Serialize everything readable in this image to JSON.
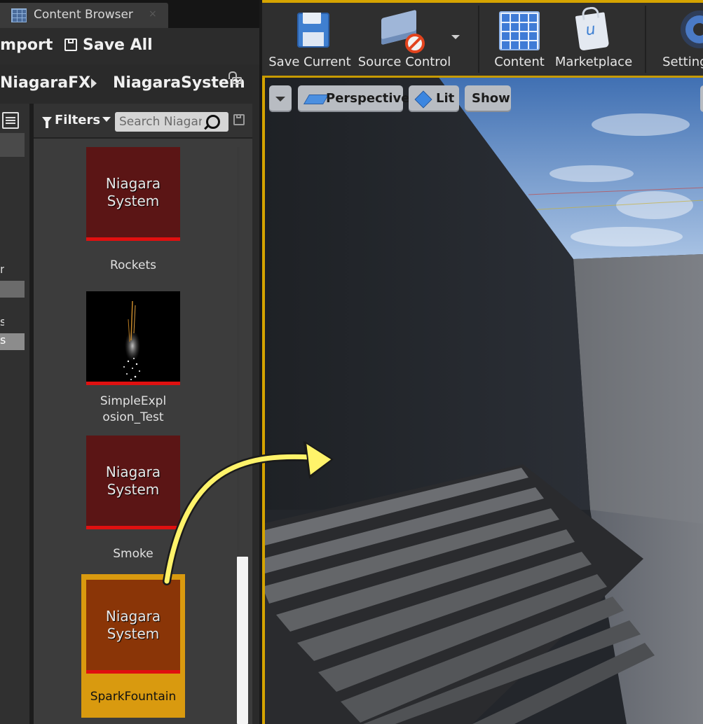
{
  "content_browser": {
    "tab_title": "Content Browser",
    "tab_close": "×",
    "toolbar": {
      "import_label": "Import",
      "save_all_label": "Save All"
    },
    "path": [
      "NiagaraFX",
      "NiagaraSystem"
    ],
    "sources_rows": [
      "n",
      "s",
      "s"
    ],
    "filters_label": "Filters",
    "search_placeholder": "Search Niagara",
    "assets": [
      {
        "name": "Rockets",
        "thumb_text": "Niagara System",
        "selected": false
      },
      {
        "name": "SimpleExplosion_Test",
        "thumb_text": "",
        "selected": false
      },
      {
        "name": "Smoke",
        "thumb_text": "Niagara System",
        "selected": false
      },
      {
        "name": "SparkFountain",
        "thumb_text": "Niagara System",
        "selected": true
      }
    ]
  },
  "main_toolbar": {
    "save_current": "Save Current",
    "source_control": "Source Control",
    "content": "Content",
    "marketplace": "Marketplace",
    "settings": "Settings"
  },
  "viewport": {
    "perspective_label": "Perspective",
    "lit_label": "Lit",
    "show_label": "Show"
  },
  "annotation": {
    "arrow_color": "#fff36a",
    "meaning": "drag SparkFountain into viewport"
  },
  "colors": {
    "editor_accent": "#d5a400",
    "thumb_bg": "#5b1515",
    "thumb_bar": "#e01010",
    "selected_bg": "#d99a0f",
    "selected_thumb_bg": "#8a3507"
  }
}
